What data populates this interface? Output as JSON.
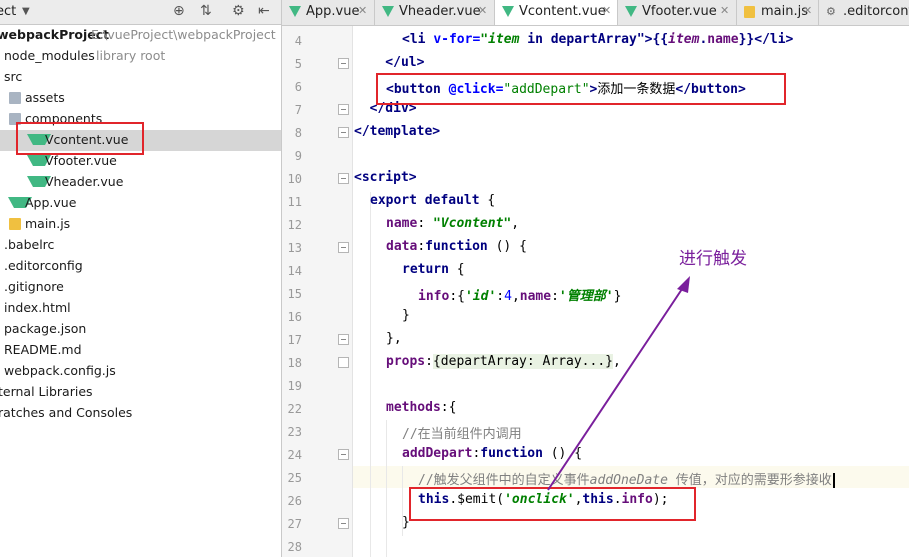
{
  "project_panel": {
    "header_title": "ect",
    "items": [
      {
        "label": "webpackProject",
        "sub": "E:\\vueProject\\webpackProject",
        "bold": true
      },
      {
        "label": "node_modules",
        "sub": "library root"
      },
      {
        "label": "src",
        "sub": ""
      },
      {
        "label": "assets",
        "sub": ""
      },
      {
        "label": "components",
        "sub": ""
      },
      {
        "label": "Vcontent.vue",
        "sub": ""
      },
      {
        "label": "Vfooter.vue",
        "sub": ""
      },
      {
        "label": "Vheader.vue",
        "sub": ""
      },
      {
        "label": "App.vue",
        "sub": ""
      },
      {
        "label": "main.js",
        "sub": ""
      },
      {
        "label": ".babelrc",
        "sub": ""
      },
      {
        "label": ".editorconfig",
        "sub": ""
      },
      {
        "label": ".gitignore",
        "sub": ""
      },
      {
        "label": "index.html",
        "sub": ""
      },
      {
        "label": "package.json",
        "sub": ""
      },
      {
        "label": "README.md",
        "sub": ""
      },
      {
        "label": "webpack.config.js",
        "sub": ""
      },
      {
        "label": "ternal Libraries",
        "sub": ""
      },
      {
        "label": "ratches and Consoles",
        "sub": ""
      }
    ]
  },
  "tabs": [
    {
      "label": "App.vue",
      "active": false
    },
    {
      "label": "Vheader.vue",
      "active": false
    },
    {
      "label": "Vcontent.vue",
      "active": true
    },
    {
      "label": "Vfooter.vue",
      "active": false
    },
    {
      "label": "main.js",
      "active": false
    },
    {
      "label": ".editorconf",
      "active": false
    }
  ],
  "line_numbers": [
    "4",
    "5",
    "6",
    "7",
    "8",
    "9",
    "10",
    "11",
    "12",
    "13",
    "14",
    "15",
    "16",
    "17",
    "18",
    "19",
    "22",
    "23",
    "24",
    "25",
    "26",
    "27",
    "28"
  ],
  "code": {
    "l4": {
      "indent": "      ",
      "t1": "<li ",
      "a1": "v-for=",
      "s1": "\"item",
      "p1": " in ",
      "s2": "departArray\"",
      "t2": ">{{",
      "x1": "item",
      "t3": ".",
      "x2": "name",
      "t4": "}}</li>"
    },
    "l5": "    </ul>",
    "l6": {
      "t1": "<button ",
      "a1": "@click=",
      "s1": "\"",
      "s2": "addDepart",
      "s3": "\"",
      "t2": ">",
      "cn": "添加一条数据",
      "t3": "</button>"
    },
    "l7": "  </div>",
    "l8": "</template>",
    "l10": "<script>",
    "l11": {
      "kw1": "export default",
      "rest": " {"
    },
    "l12": {
      "prop": "name",
      "c": ": ",
      "str": "\"Vcontent\"",
      "end": ","
    },
    "l13": {
      "prop": "data",
      "c": ":",
      "kw": "function",
      "end": " () {"
    },
    "l14": {
      "kw": "return",
      "end": " {"
    },
    "l15": {
      "p1": "info",
      "c1": ":{",
      "s1": "'id'",
      "c2": ":",
      "n1": "4",
      "c3": ",",
      "p2": "name",
      "c4": ":",
      "s2": "'管理部'",
      "c5": "}"
    },
    "l16": "}",
    "l17": "},",
    "l18": {
      "prop": "props",
      "c": ":",
      "fold": "{departArray: Array...}",
      "end": ","
    },
    "l22": {
      "prop": "methods",
      "end": ":{"
    },
    "l23": "//在当前组件内调用",
    "l24": {
      "prop": "addDepart",
      "c": ":",
      "kw": "function",
      "end": " () {"
    },
    "l25": {
      "cm1": "//触发父组件中的自定义事件",
      "cm2": "addOneDate",
      "cm3": " 传值，对应的需要形参接收"
    },
    "l26": {
      "kw1": "this",
      "c1": ".$emit(",
      "s1": "'onclick'",
      "c2": ",",
      "kw2": "this",
      "c3": ".",
      "p1": "info",
      "c4": ");"
    },
    "l27": "}"
  },
  "annotation": {
    "text": "进行触发",
    "color": "#7a1f9c"
  },
  "highlight_color": "#e1252b"
}
